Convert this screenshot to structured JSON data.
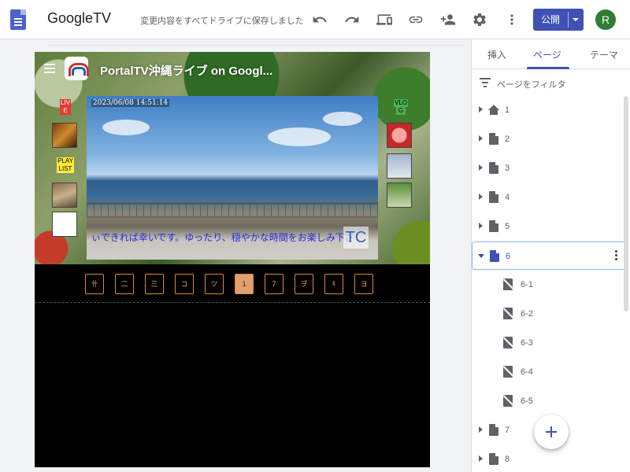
{
  "topbar": {
    "site_title": "GoogleTV",
    "save_status": "変更内容をすべてドライブに保存しました",
    "publish_label": "公開",
    "avatar_initial": "R",
    "icons": [
      "undo-icon",
      "redo-icon",
      "preview-devices-icon",
      "link-icon",
      "add-person-icon",
      "settings-icon",
      "more-vert-icon"
    ]
  },
  "page": {
    "site_title": "PortalTV沖縄ライブ on Googl...",
    "left_badges": [
      "LIV",
      "E",
      "PLAY",
      "LIST"
    ],
    "right_badge": [
      "VLO",
      "G"
    ],
    "video_timestamp": "2023/06/08 14:51:14",
    "ticker_text": "ぃできれば幸いです。ゆったり、穏やかな時間をお楽しみ下さ",
    "ticker_overlay": "TC",
    "tabs": [
      "卄",
      "二",
      "三",
      "コ",
      "ツ",
      "1",
      "7",
      "ヺ",
      "ｷ",
      "ヨ"
    ],
    "active_tab_index": 5
  },
  "panel": {
    "tabs": [
      "挿入",
      "ページ",
      "テーマ"
    ],
    "active_tab": "ページ",
    "filter_placeholder": "ページをフィルタ",
    "pages": [
      "1",
      "2",
      "3",
      "4",
      "5",
      "6",
      "7",
      "8"
    ],
    "active_page": "6",
    "children": [
      "6-1",
      "6-2",
      "6-3",
      "6-4",
      "6-5"
    ]
  },
  "colors": {
    "accent": "#3f51b5",
    "avatar": "#2e7d32",
    "tab_border": "#d98a3a"
  }
}
